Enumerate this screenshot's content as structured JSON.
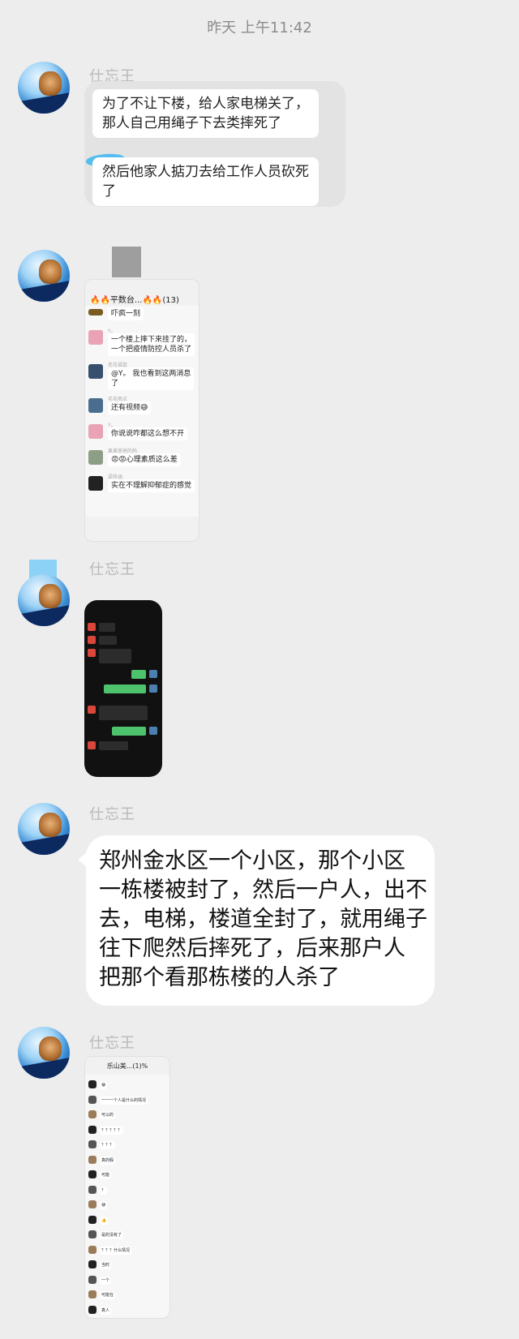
{
  "timestamp": "昨天 上午11:42",
  "sender_name": "仕忘王",
  "messages": [
    {
      "type": "record",
      "bubbles": [
        "为了不让下楼，给人家电梯关了，\n那人自己用绳子下去类摔死了",
        "然后他家人掂刀去给工作人员砍死\n了"
      ]
    },
    {
      "type": "image",
      "screenshot": {
        "title": "🔥🔥平数台...🔥🔥(13)",
        "rows": [
          {
            "name": "",
            "text": "吓疯一刻"
          },
          {
            "name": "Y。",
            "text": "一个楼上摔下来挂了的，\n一个把疫情防控人员杀了"
          },
          {
            "name": "老花福鼠",
            "text": "@Y。 我也看到这两消息\n了"
          },
          {
            "name": "毛毛雨点",
            "text": "还有视频😅"
          },
          {
            "name": "Y。",
            "text": "你说说咋都这么想不开"
          },
          {
            "name": "果果爸爸的妈",
            "text": "😡😡心理素质这么差"
          },
          {
            "name": "梁梓涵",
            "text": "实在不理解抑郁症的感觉"
          }
        ]
      }
    },
    {
      "type": "image",
      "screenshot": {
        "theme": "dark"
      }
    },
    {
      "type": "text",
      "text": "郑州金水区一个小区，那个小区\n一栋楼被封了，然后一户人，出不\n去，电梯，楼道全封了，就用绳子\n往下爬然后摔死了，后来那户人\n把那个看那栋楼的人杀了"
    },
    {
      "type": "image",
      "screenshot": {
        "title": "乐山美...(1)%",
        "rows": [
          {
            "text": "😀"
          },
          {
            "text": "一一一个人是什么的情况"
          },
          {
            "text": "可以的"
          },
          {
            "text": "？？？？？"
          },
          {
            "text": "？？？"
          },
          {
            "text": "真的假"
          },
          {
            "text": "可能"
          },
          {
            "text": "？"
          },
          {
            "text": "😅"
          },
          {
            "text": "👍"
          },
          {
            "text": "是的没有了"
          },
          {
            "text": "？？？什么情况"
          },
          {
            "text": "当时"
          },
          {
            "text": "一个"
          },
          {
            "text": "可能在"
          },
          {
            "text": "真人"
          }
        ]
      }
    }
  ],
  "colors": {
    "background": "#ededed",
    "bubble": "#ffffff",
    "record": "#e3e3e3",
    "wechat_green": "#4ec36d"
  }
}
